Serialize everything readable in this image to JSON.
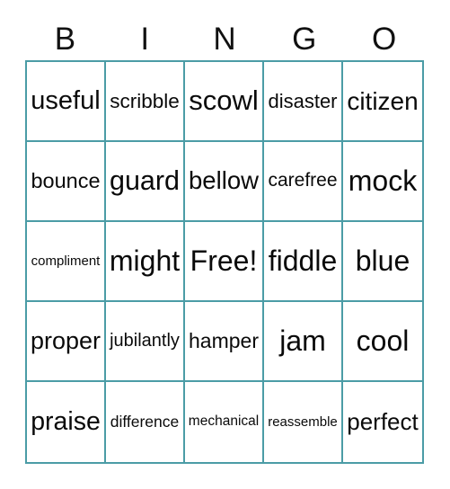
{
  "card": {
    "title_letters": [
      "B",
      "I",
      "N",
      "G",
      "O"
    ],
    "accent_color": "#4b9ca6",
    "text_color": "#0a0a0a",
    "background_color": "#ffffff",
    "columns": 5,
    "rows": 5,
    "free_space": "Free!",
    "grid": [
      [
        "useful",
        "scribble",
        "scowl",
        "disaster",
        "citizen"
      ],
      [
        "bounce",
        "guard",
        "bellow",
        "carefree",
        "mock"
      ],
      [
        "compliment",
        "might",
        "Free!",
        "fiddle",
        "blue"
      ],
      [
        "proper",
        "jubilantly",
        "hamper",
        "jam",
        "cool"
      ],
      [
        "praise",
        "difference",
        "mechanical",
        "reassemble",
        "perfect"
      ]
    ]
  }
}
